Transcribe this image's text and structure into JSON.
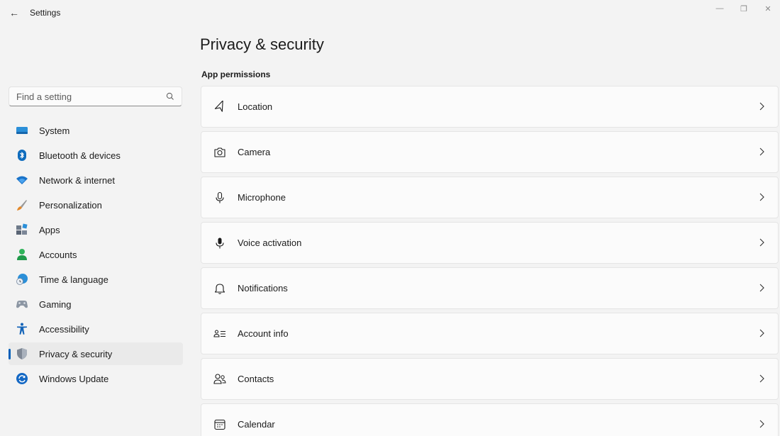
{
  "window": {
    "title": "Settings",
    "back_glyph": "←",
    "minimize_glyph": "—",
    "restore_glyph": "❐",
    "close_glyph": "✕"
  },
  "search": {
    "placeholder": "Find a setting"
  },
  "sidebar": {
    "items": [
      {
        "label": "System",
        "icon": "system-icon"
      },
      {
        "label": "Bluetooth & devices",
        "icon": "bluetooth-icon"
      },
      {
        "label": "Network & internet",
        "icon": "wifi-icon"
      },
      {
        "label": "Personalization",
        "icon": "brush-icon"
      },
      {
        "label": "Apps",
        "icon": "apps-icon"
      },
      {
        "label": "Accounts",
        "icon": "person-icon"
      },
      {
        "label": "Time & language",
        "icon": "globe-clock-icon"
      },
      {
        "label": "Gaming",
        "icon": "controller-icon"
      },
      {
        "label": "Accessibility",
        "icon": "accessibility-icon"
      },
      {
        "label": "Privacy & security",
        "icon": "shield-icon",
        "selected": true
      },
      {
        "label": "Windows Update",
        "icon": "update-icon"
      }
    ]
  },
  "main": {
    "title": "Privacy & security",
    "section": "App permissions",
    "permissions": [
      {
        "label": "Location",
        "icon": "location-icon"
      },
      {
        "label": "Camera",
        "icon": "camera-icon"
      },
      {
        "label": "Microphone",
        "icon": "microphone-icon"
      },
      {
        "label": "Voice activation",
        "icon": "voice-activation-icon"
      },
      {
        "label": "Notifications",
        "icon": "bell-icon"
      },
      {
        "label": "Account info",
        "icon": "account-info-icon"
      },
      {
        "label": "Contacts",
        "icon": "contacts-icon"
      },
      {
        "label": "Calendar",
        "icon": "calendar-icon"
      }
    ]
  },
  "colors": {
    "accent": "#005fb8",
    "background": "#f3f3f3",
    "card": "#fbfbfb",
    "selected": "#eaeaea"
  }
}
